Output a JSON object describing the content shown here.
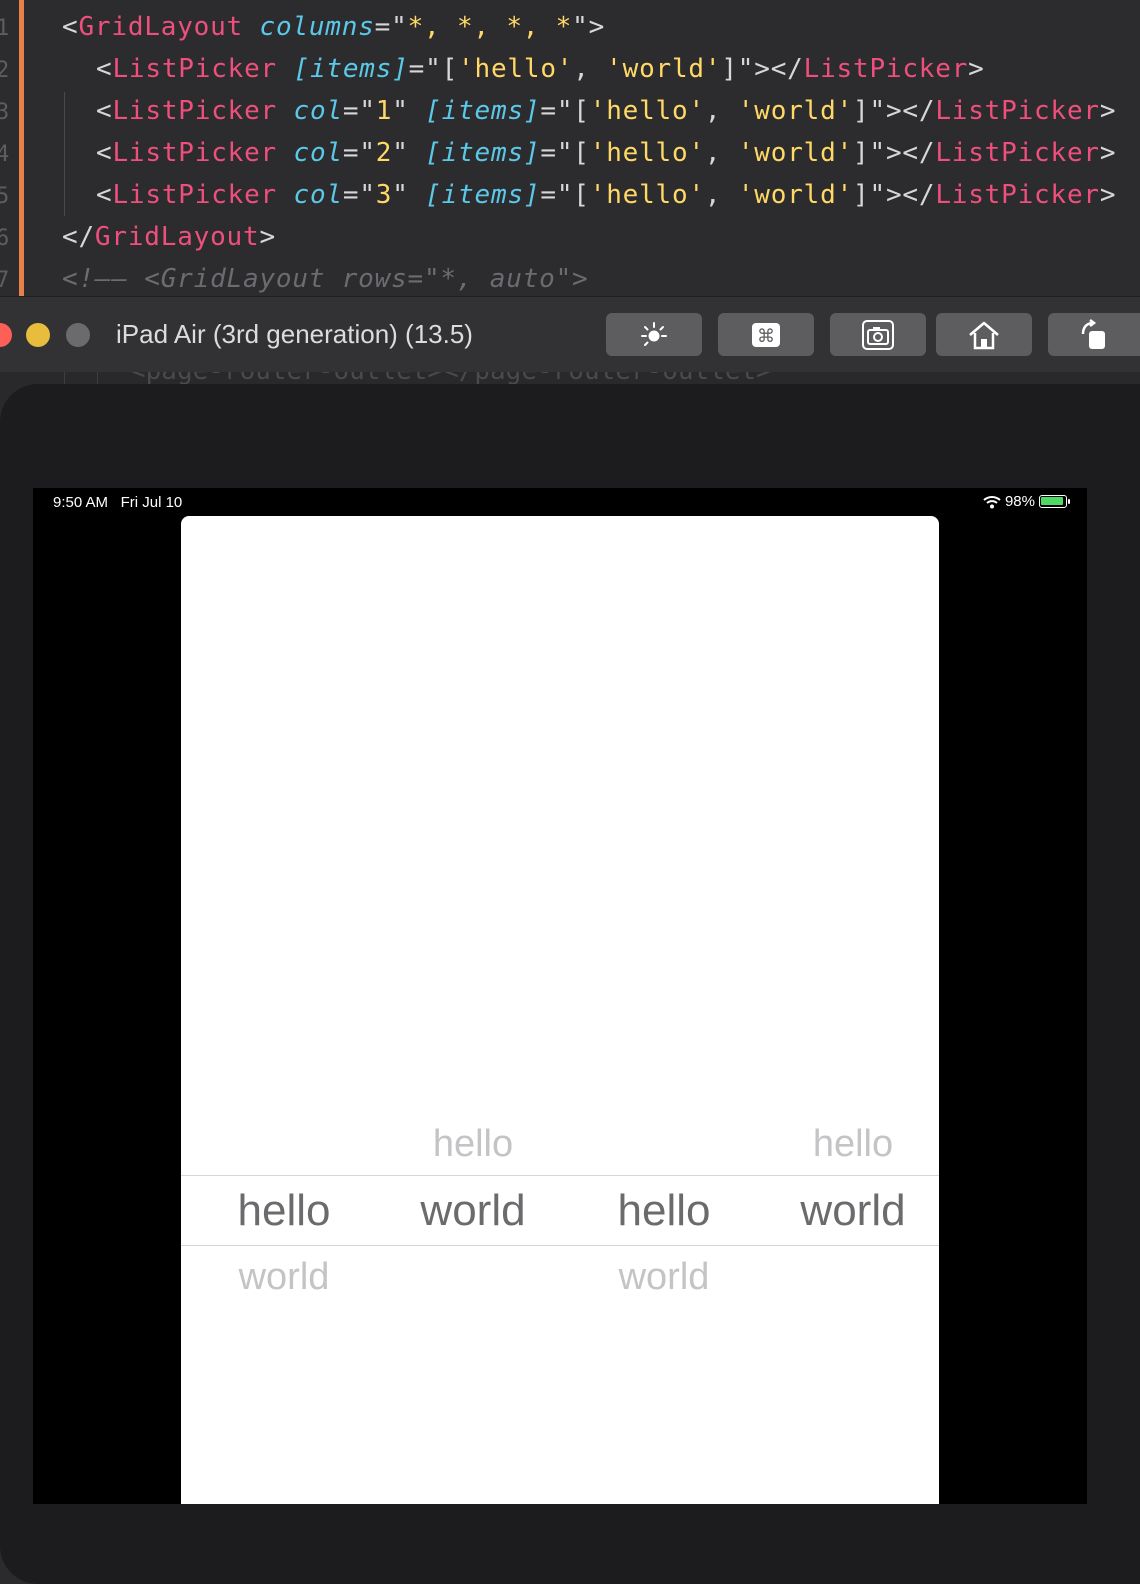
{
  "editor": {
    "line_numbers": [
      "1",
      "2",
      "3",
      "4",
      "5",
      "6",
      "7"
    ],
    "lines": [
      {
        "t0": "<",
        "tag": "GridLayout",
        "a1": "columns",
        "eq1": "=\"",
        "v1": "*, *, *, *",
        "end": "\">"
      },
      {
        "t0": "<",
        "tag": "ListPicker",
        "a1": "[items]",
        "eq1": "=\"[",
        "v1": "'hello'",
        "comma": ", ",
        "v2": "'world'",
        "end": "]\"></",
        "tag2": "ListPicker",
        "close": ">"
      },
      {
        "t0": "<",
        "tag": "ListPicker",
        "a1": "col",
        "eq1": "=\"",
        "n1": "1",
        "mid": "\" ",
        "a2": "[items]",
        "eq2": "=\"[",
        "v1": "'hello'",
        "comma": ", ",
        "v2": "'world'",
        "end": "]\"></",
        "tag2": "ListPicker",
        "close": ">"
      },
      {
        "t0": "<",
        "tag": "ListPicker",
        "a1": "col",
        "eq1": "=\"",
        "n1": "2",
        "mid": "\" ",
        "a2": "[items]",
        "eq2": "=\"[",
        "v1": "'hello'",
        "comma": ", ",
        "v2": "'world'",
        "end": "]\"></",
        "tag2": "ListPicker",
        "close": ">"
      },
      {
        "t0": "<",
        "tag": "ListPicker",
        "a1": "col",
        "eq1": "=\"",
        "n1": "3",
        "mid": "\" ",
        "a2": "[items]",
        "eq2": "=\"[",
        "v1": "'hello'",
        "comma": ", ",
        "v2": "'world'",
        "end": "]\"></",
        "tag2": "ListPicker",
        "close": ">"
      },
      {
        "t0": "</",
        "tag": "GridLayout",
        "close": ">"
      },
      {
        "comment": "<!—— <GridLayout rows=\"*, auto\">"
      }
    ],
    "ghost_line": "<page-router-outlet></page-router-outlet>"
  },
  "simulator": {
    "title": "iPad Air (3rd generation) (13.5)",
    "buttons": [
      "brightness-icon",
      "command-icon",
      "screenshot-icon",
      "home-icon",
      "rotate-icon"
    ],
    "colors": {
      "close": "#fe5f57",
      "minimize": "#e8bd3d",
      "zoom": "#6b6b6d",
      "button_bg": "#5d5d60"
    }
  },
  "device": {
    "status": {
      "time": "9:50 AM",
      "date": "Fri Jul 10",
      "battery": "98%",
      "battery_level": 0.98
    },
    "pickers": [
      {
        "above": "",
        "selected": "hello",
        "below": "world"
      },
      {
        "above": "hello",
        "selected": "world",
        "below": ""
      },
      {
        "above": "",
        "selected": "hello",
        "below": "world"
      },
      {
        "above": "hello",
        "selected": "world",
        "below": ""
      }
    ]
  }
}
